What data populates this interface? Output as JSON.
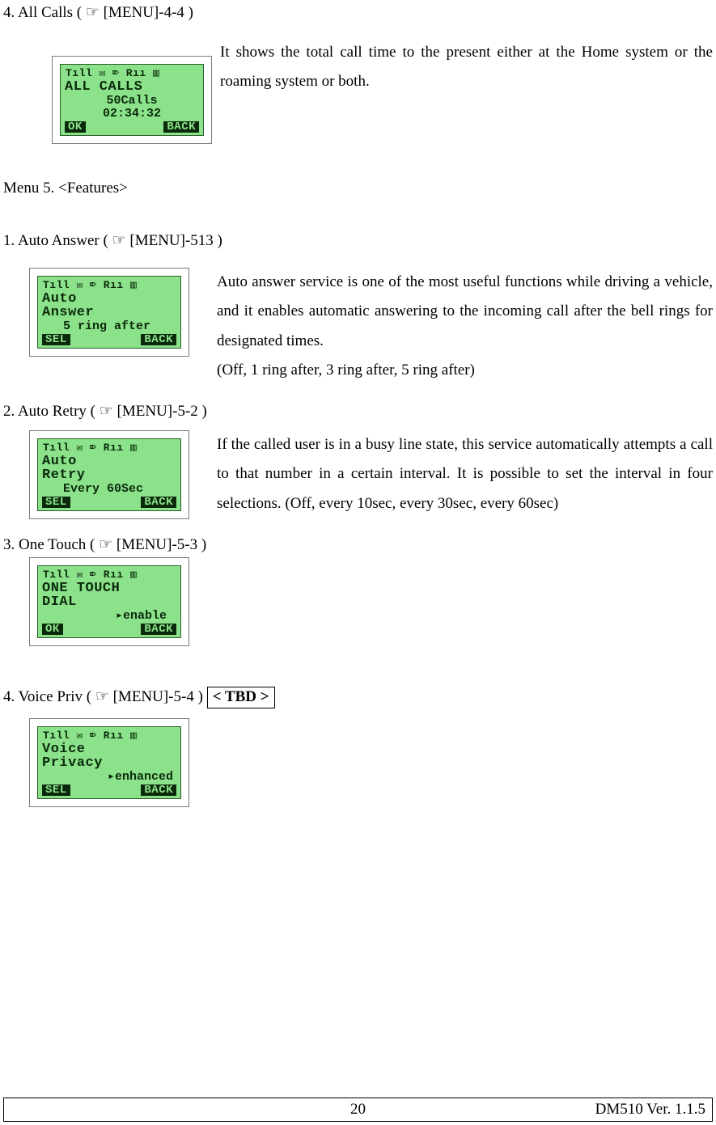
{
  "sec_all_calls": {
    "heading": "4. All Calls ( ☞ [MENU]-4-4 )",
    "body": "It shows the total call time to the present either at the Home system or the roaming system or both.",
    "lcd": {
      "status": "Tıll  ✉ ⌦ Rıı ▥",
      "title": "ALL CALLS",
      "line1": "50Calls",
      "line2": "02:34:32",
      "soft_left": "OK",
      "soft_right": "BACK"
    }
  },
  "menu5_heading": "Menu 5. <Features>",
  "sec_auto_answer": {
    "heading": "1. Auto Answer ( ☞ [MENU]-513 )",
    "body1": "Auto answer service is one of the most useful functions while driving a vehicle, and it enables automatic answering to the incoming call after the bell rings for designated times.",
    "body2": "(Off, 1 ring after, 3 ring after, 5 ring after)",
    "lcd": {
      "status": "Tıll  ✉ ⌦ Rıı ▥",
      "title": "Auto\nAnswer",
      "line1": "5 ring after",
      "soft_left": "SEL",
      "soft_right": "BACK"
    }
  },
  "sec_auto_retry": {
    "heading": "2. Auto Retry ( ☞ [MENU]-5-2 )",
    "body": "If the called user is in a busy line state, this service automatically attempts a call to that number in a certain interval. It is possible to set the interval in four selections. (Off, every 10sec, every 30sec, every 60sec)",
    "lcd": {
      "status": "Tıll  ✉ ⌦ Rıı ▥",
      "title": "Auto\nRetry",
      "line1": "Every 60Sec",
      "soft_left": "SEL",
      "soft_right": "BACK"
    }
  },
  "sec_one_touch": {
    "heading": "3. One Touch ( ☞ [MENU]-5-3 )",
    "lcd": {
      "status": "Tıll  ✉ ⌦ Rıı ▥",
      "title": "ONE TOUCH\nDIAL",
      "line1": "▸enable",
      "soft_left": "OK",
      "soft_right": "BACK"
    }
  },
  "sec_voice_priv": {
    "heading": "4. Voice Priv ( ☞ [MENU]-5-4 )      ",
    "tbd": "< TBD >",
    "lcd": {
      "status": "Tıll  ✉ ⌦ Rıı ▥",
      "title": "Voice\nPrivacy",
      "line1": "▸enhanced",
      "soft_left": "SEL",
      "soft_right": "BACK"
    }
  },
  "footer": {
    "page": "20",
    "doc": "DM510    Ver. 1.1.5"
  }
}
